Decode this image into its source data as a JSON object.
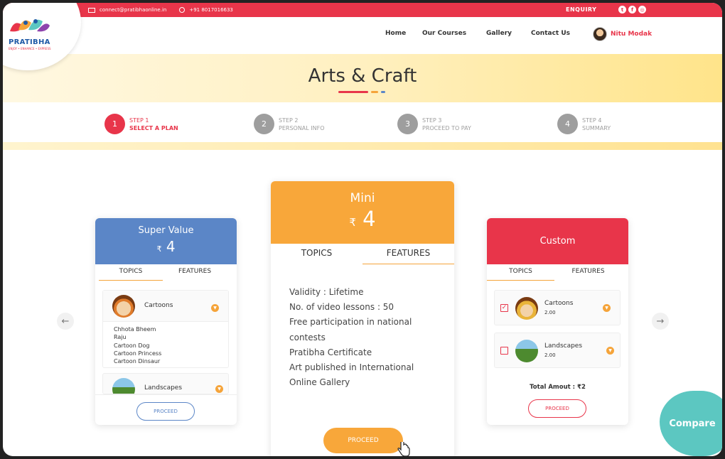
{
  "topbar": {
    "email": "connect@pratibhaonline.in",
    "phone": "+91 8017016633",
    "enquiry": "ENQUIRY",
    "social": [
      "twitter-icon",
      "facebook-icon",
      "instagram-icon"
    ]
  },
  "logo": {
    "name": "PRATIBHA",
    "tagline": "ENJOY • ENHANCE • EXPRESS"
  },
  "nav": {
    "items": [
      "Home",
      "Our Courses",
      "Gallery",
      "Contact Us"
    ],
    "user": "Nitu Modak"
  },
  "banner": {
    "title": "Arts & Craft"
  },
  "steps": [
    {
      "num": "1",
      "step": "STEP 1",
      "label": "SELECT A PLAN"
    },
    {
      "num": "2",
      "step": "STEP 2",
      "label": "PERSONAL INFO"
    },
    {
      "num": "3",
      "step": "STEP 3",
      "label": "PROCEED TO PAY"
    },
    {
      "num": "4",
      "step": "STEP 4",
      "label": "SUMMARY"
    }
  ],
  "plans": {
    "super_value": {
      "name": "Super Value",
      "currency": "₹",
      "price": "4",
      "tab_topics": "TOPICS",
      "tab_features": "FEATURES",
      "topic1": "Cartoons",
      "topic1_items": [
        "Chhota Bheem",
        "Raju",
        "Cartoon Dog",
        "Cartoon Princess",
        "Cartoon Dinsaur"
      ],
      "topic2": "Landscapes",
      "proceed": "PROCEED",
      "color": "#5b86c7"
    },
    "mini": {
      "name": "Mini",
      "currency": "₹",
      "price": "4",
      "tab_topics": "TOPICS",
      "tab_features": "FEATURES",
      "features": [
        "Validity : Lifetime",
        "No. of video lessons : 50",
        "Free participation in national",
        "contests",
        "Pratibha Certificate",
        "Art published in International",
        "Online Gallery"
      ],
      "proceed": "PROCEED",
      "color": "#f8a73a"
    },
    "custom": {
      "name": "Custom",
      "tab_topics": "TOPICS",
      "tab_features": "FEATURES",
      "topic1": "Cartoons",
      "topic1_price": "2.00",
      "topic2": "Landscapes",
      "topic2_price": "2.00",
      "total": "Total Amout : ₹2",
      "proceed": "PROCEED",
      "color": "#e8354a"
    }
  },
  "compare": "Compare",
  "arrows": {
    "left": "←",
    "right": "→"
  }
}
